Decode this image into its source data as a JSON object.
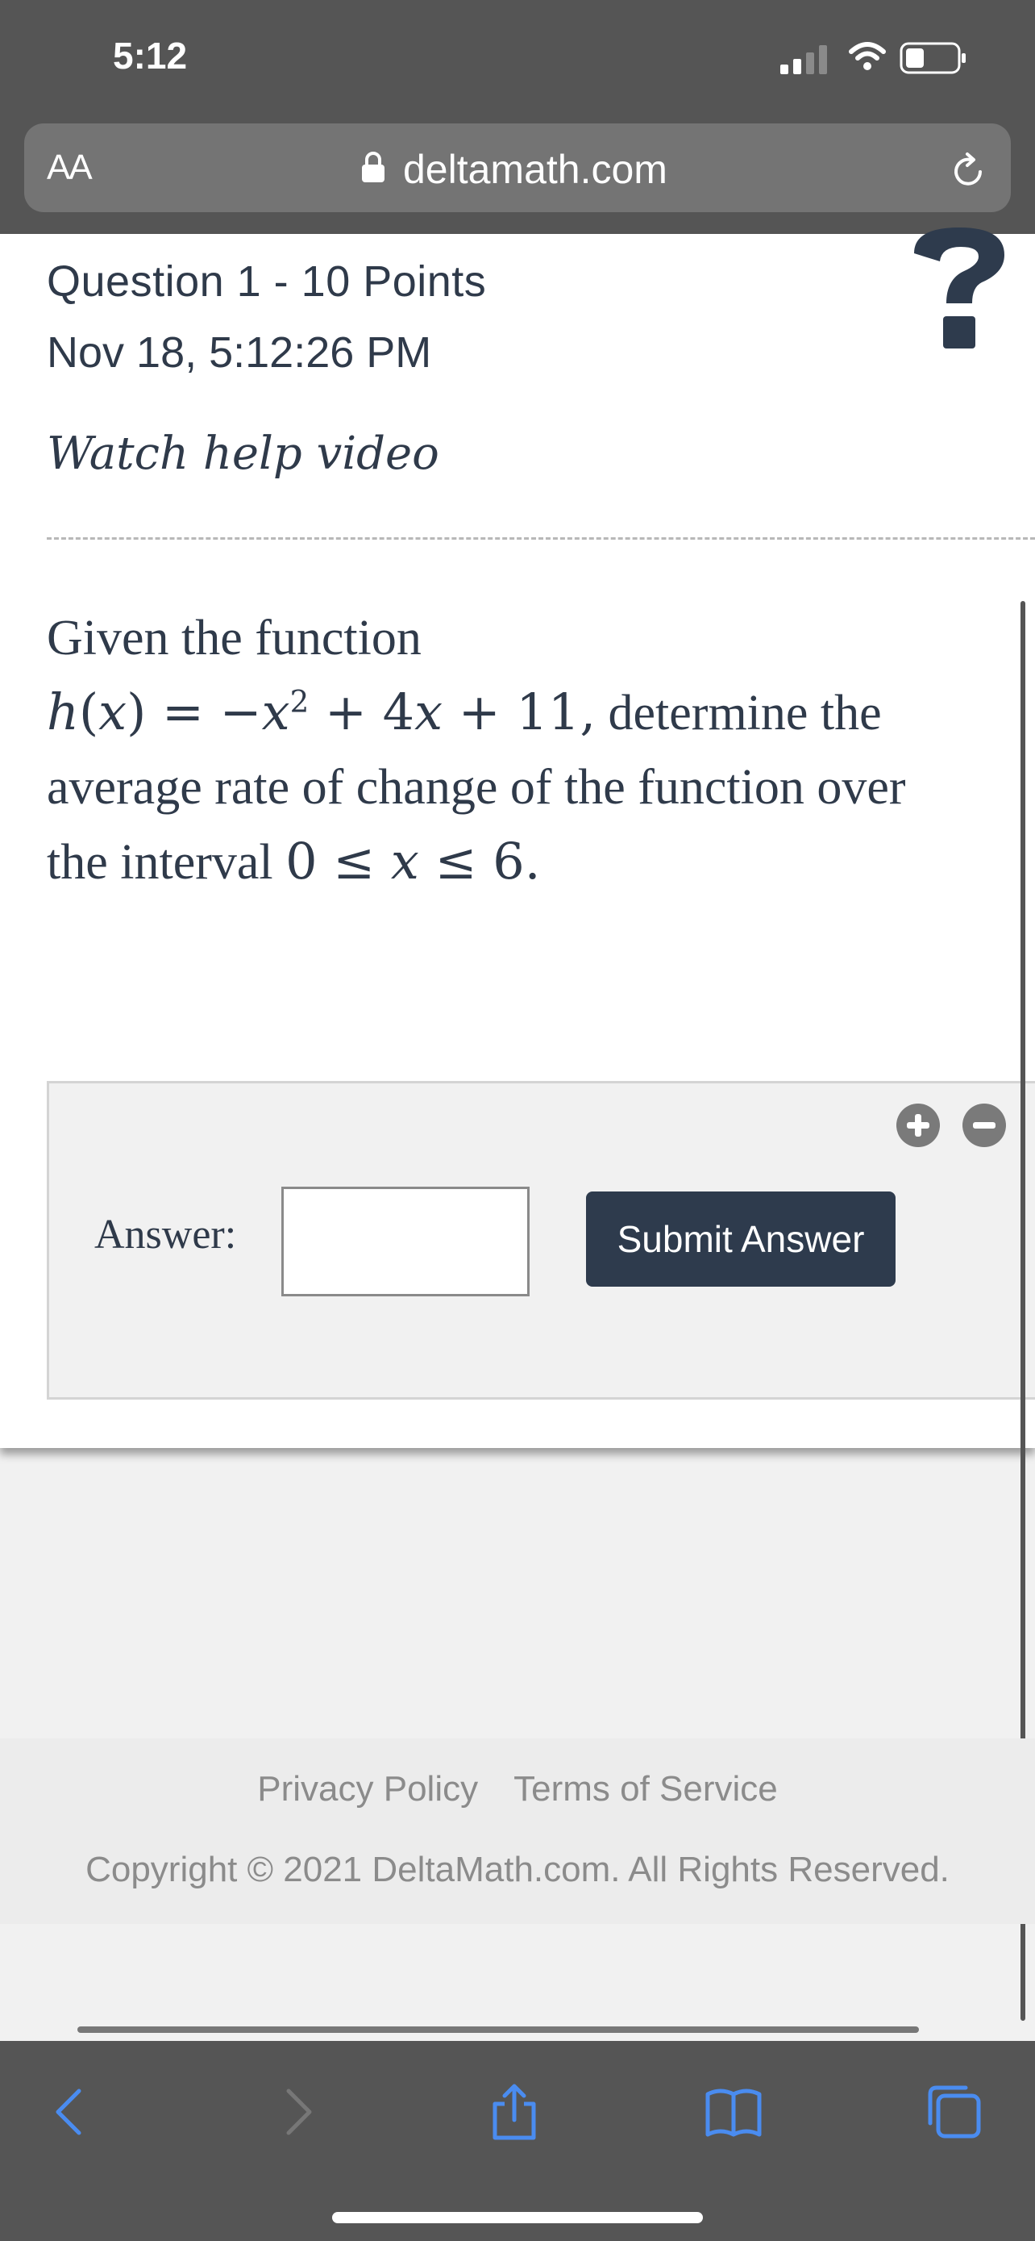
{
  "status_bar": {
    "time": "5:12"
  },
  "browser": {
    "text_size_label": "AA",
    "url": "deltamath.com"
  },
  "question": {
    "title": "Question 1 - 10 Points",
    "timestamp": "Nov 18, 5:12:26 PM",
    "help_link": "Watch help video"
  },
  "problem": {
    "line1": "Given the function",
    "func_name": "h",
    "func_var": "x",
    "rhs_pre": " = −",
    "rhs_var": "x",
    "rhs_exp": "2",
    "rhs_mid": " + 4",
    "rhs_var2": "x",
    "rhs_end": " + 11,",
    "after_eq": " determine the",
    "line3": "average rate of change of the function over",
    "interval_pre": "the interval ",
    "interval_a": "0 ≤ ",
    "interval_var": "x",
    "interval_b": " ≤ 6."
  },
  "answer": {
    "label": "Answer:",
    "value": "",
    "submit_label": "Submit Answer"
  },
  "footer": {
    "privacy": "Privacy Policy",
    "terms": "Terms of Service",
    "copyright": "Copyright © 2021 DeltaMath.com. All Rights Reserved."
  },
  "colors": {
    "accent_dark": "#2e3b4d",
    "browser_chrome": "#555555",
    "link_gray": "#8b8b8b"
  }
}
